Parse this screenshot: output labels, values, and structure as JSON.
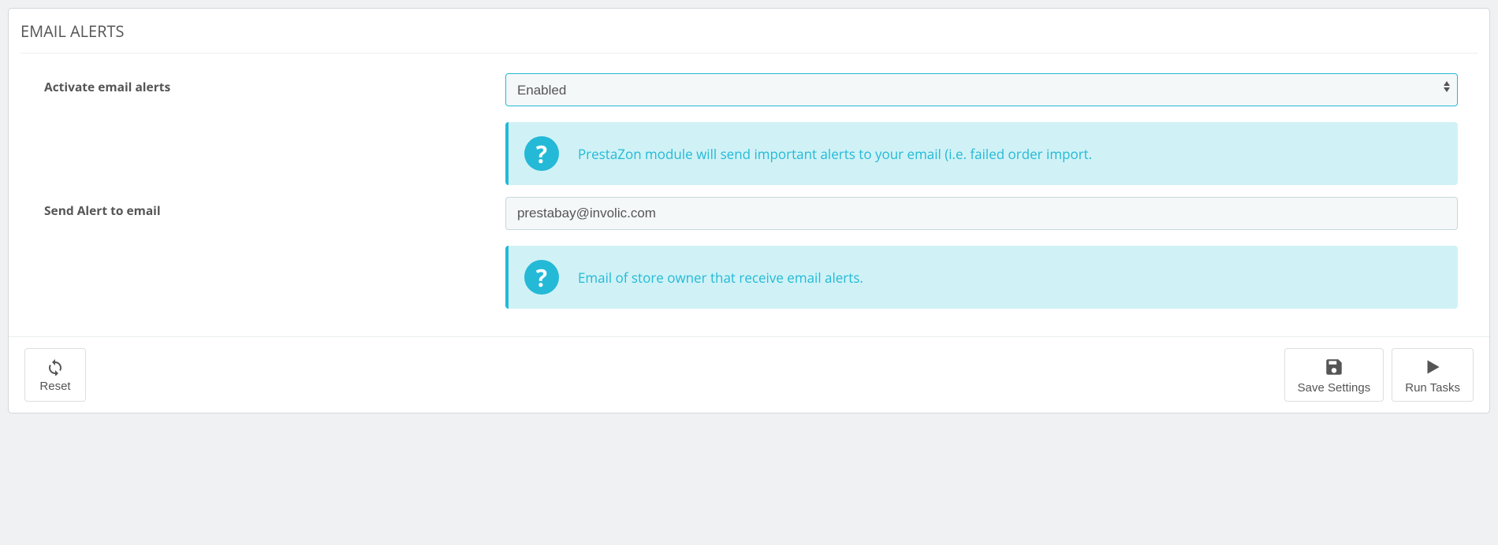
{
  "panel": {
    "title": "EMAIL ALERTS"
  },
  "fields": {
    "activate": {
      "label": "Activate email alerts",
      "value": "Enabled",
      "help": "PrestaZon module will send important alerts to your email (i.e. failed order import."
    },
    "sendTo": {
      "label": "Send Alert to email",
      "value": "prestabay@involic.com",
      "help": "Email of store owner that receive email alerts."
    }
  },
  "buttons": {
    "reset": "Reset",
    "save": "Save Settings",
    "run": "Run Tasks"
  }
}
